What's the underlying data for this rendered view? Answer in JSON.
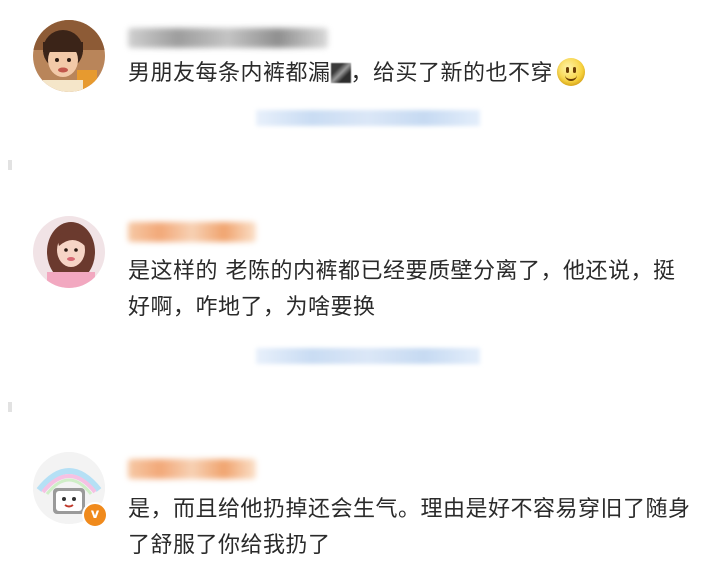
{
  "comments": [
    {
      "text_before": "男朋友每条内裤都漏",
      "text_after": "，给买了新的也不穿",
      "avatar": "avatar-girl-photo",
      "emoji": "smile-emoji",
      "censored": "mosaic-block"
    },
    {
      "text": "是这样的 老陈的内裤都已经要质壁分离了，他还说，挺好啊，咋地了，为啥要换",
      "avatar": "avatar-woman-photo"
    },
    {
      "text": "是，而且给他扔掉还会生气。理由是好不容易穿旧了随身了舒服了你给我扔了",
      "avatar": "avatar-cartoon",
      "badge": "v"
    }
  ],
  "colors": {
    "text": "#2a2a2a",
    "reply_blur": "#c9dcf3",
    "badge": "#f08a1c"
  }
}
